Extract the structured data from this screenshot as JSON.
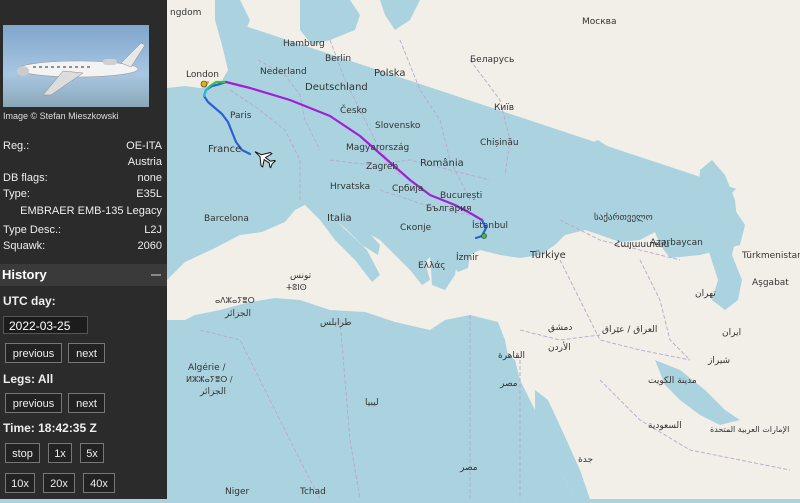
{
  "aircraft": {
    "image_credit": "Image © Stefan Mieszkowski",
    "fields": [
      {
        "key": "Reg.:",
        "value": "OE-ITA"
      },
      {
        "key": "",
        "value": "Austria"
      },
      {
        "key": "DB flags:",
        "value": "none"
      },
      {
        "key": "Type:",
        "value": "E35L"
      },
      {
        "key": "",
        "value": "EMBRAER EMB-135 Legacy"
      },
      {
        "key": "Type Desc.:",
        "value": "L2J"
      },
      {
        "key": "Squawk:",
        "value": "2060"
      }
    ]
  },
  "history": {
    "title": "History",
    "utc_day_label": "UTC day:",
    "utc_day": "2022-03-25",
    "day_prev": "previous",
    "day_next": "next",
    "legs_label": "Legs: All",
    "legs_prev": "previous",
    "legs_next": "next",
    "time_label": "Time: 18:42:35 Z",
    "playback": [
      "stop",
      "1x",
      "5x",
      "10x",
      "20x",
      "40x"
    ]
  },
  "map": {
    "labels": {
      "kingdom": "ngdom",
      "london": "London",
      "paris": "Paris",
      "france": "France",
      "nederland": "Nederland",
      "hamburg": "Hamburg",
      "berlin": "Berlin",
      "deutschland": "Deutschland",
      "polska": "Polska",
      "cesko": "Česko",
      "slovensko": "Slovensko",
      "magyarorszag": "Magyarország",
      "zagreb": "Zagreb",
      "hrvatska": "Hrvatska",
      "srbija": "Србија",
      "romania": "România",
      "bucuresti": "București",
      "bulgaria": "България",
      "skopje": "Скопје",
      "italia": "Italia",
      "barcelona": "Barcelona",
      "istanbul": "İstanbul",
      "izmir": "İzmir",
      "ellas": "Ελλάς",
      "turkiye": "Türkiye",
      "moskva": "Москва",
      "kyiv": "Київ",
      "chisinau": "Chișinău",
      "georgia": "საქართველო",
      "armenia": "Հայաստան",
      "azerbaycan": "Azərbaycan",
      "turkmenistan": "Türkmenistan",
      "asgabat": "Aşgabat",
      "tunis": "تونس",
      "tunisia_berber": "ⵜⵓⵏⵙ",
      "algeria_berber": "ⴰⴷⵣⴰⵢⴻⵔ",
      "algerie_ar": "الجزائر",
      "algerie": "Algérie /",
      "algerie_berber2": "ⵍⵣⵣⴰⵢⴻⵔ /",
      "algerie_ar2": "الجزائر",
      "tripoli": "طرابلس",
      "libya": "ليبيا",
      "cairo": "القاهرة",
      "egypt": "مصر",
      "damascus": "دمشق",
      "jordan": "الأردن",
      "iraq": "العراق / عێراق",
      "iran": "ایران",
      "tehran": "تهران",
      "kuwait": "مدينة الكويت",
      "shiraz": "شیراز",
      "saudi": "السعودية",
      "uae": "الإمارات العربية المتحدة",
      "jeddah": "جدة",
      "misr_south": "مصر",
      "niger": "Niger",
      "moscow_region": "Беларусь",
      "tchad": "Tchad"
    }
  },
  "colors": {
    "sidebar_bg": "#2b2b2b",
    "sea": "#aad3df",
    "land": "#f2efe9",
    "track_high": "#a020d8",
    "track_low": "#2f5fd6"
  }
}
